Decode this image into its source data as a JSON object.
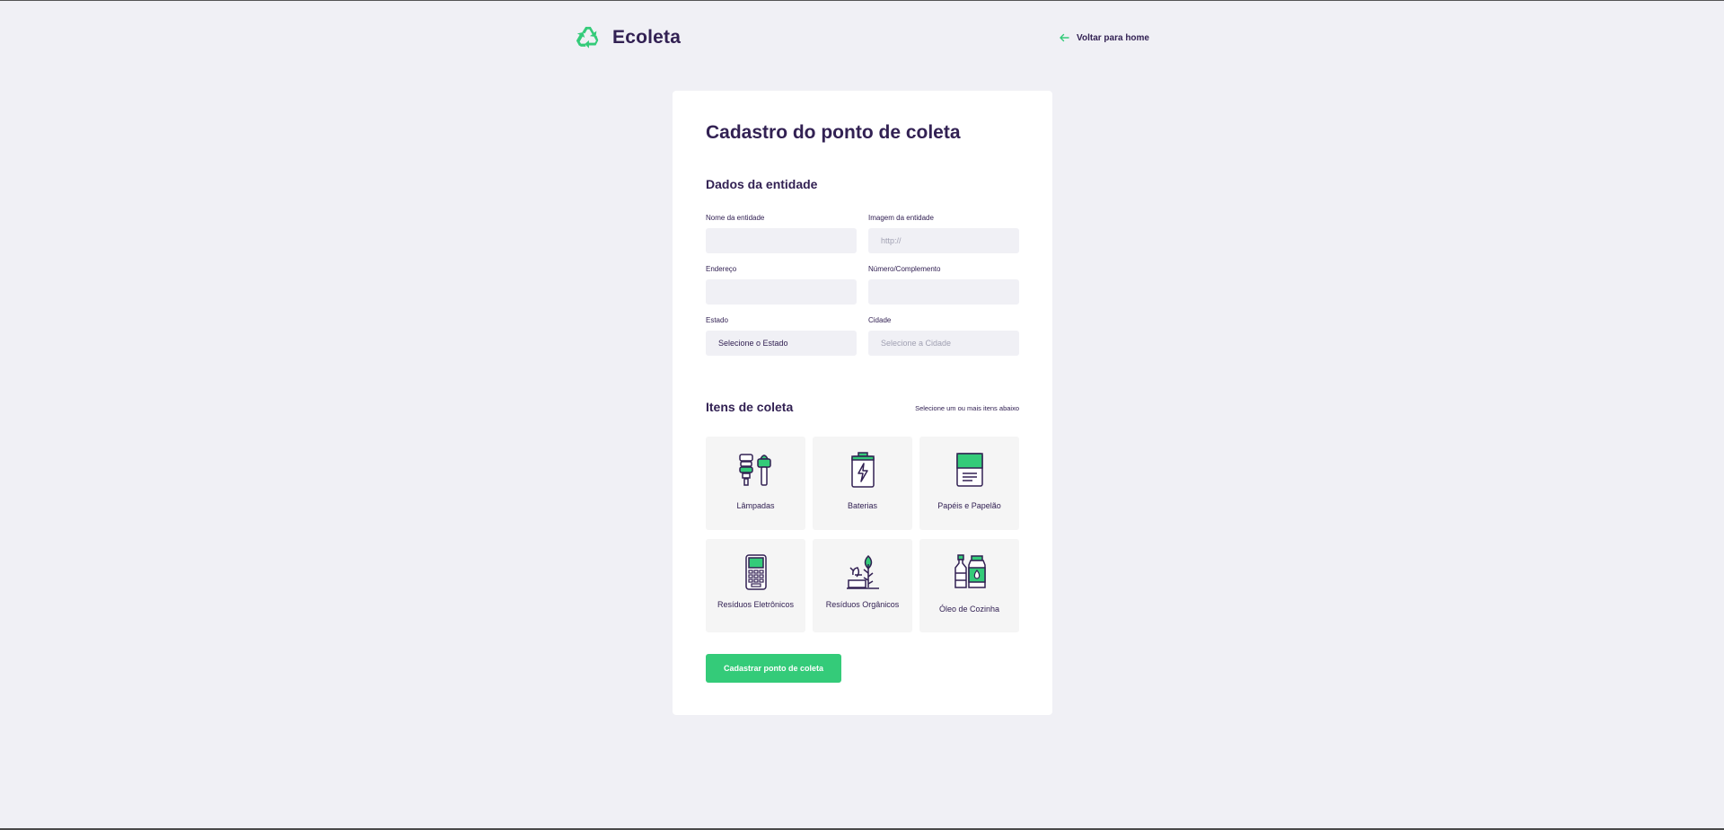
{
  "header": {
    "app_name": "Ecoleta",
    "back_link_label": "Voltar para home"
  },
  "form": {
    "title": "Cadastro do ponto de coleta",
    "entity_section": {
      "title": "Dados da entidade",
      "name_label": "Nome da entidade",
      "name_value": "",
      "image_label": "Imagem da entidade",
      "image_placeholder": "http://",
      "address_label": "Endereço",
      "address_value": "",
      "number_label": "Número/Complemento",
      "number_value": "",
      "state_label": "Estado",
      "state_selected": "Selecione o Estado",
      "city_label": "Cidade",
      "city_selected": "Selecione a Cidade"
    },
    "items_section": {
      "title": "Itens de coleta",
      "hint": "Selecione um ou mais itens abaixo",
      "items": [
        {
          "label": "Lâmpadas",
          "icon": "light-bulbs-icon"
        },
        {
          "label": "Baterias",
          "icon": "battery-icon"
        },
        {
          "label": "Papéis e Papelão",
          "icon": "paper-icon"
        },
        {
          "label": "Resíduos Eletrônicos",
          "icon": "electronic-device-icon"
        },
        {
          "label": "Resíduos Orgânicos",
          "icon": "organic-waste-icon"
        },
        {
          "label": "Óleo de Cozinha",
          "icon": "oil-bottles-icon"
        }
      ]
    },
    "submit_label": "Cadastrar ponto de coleta"
  },
  "colors": {
    "accent": "#34cb79",
    "title": "#322153",
    "background": "#f0f0f5",
    "card": "#ffffff",
    "item_background": "#f5f5f5",
    "muted_text": "#a0a0b2"
  }
}
